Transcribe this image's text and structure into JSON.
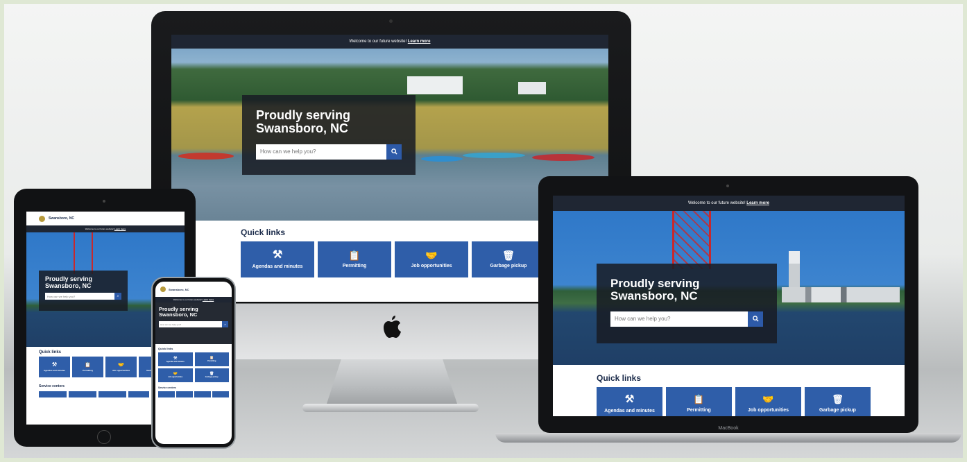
{
  "site": {
    "banner_text": "Welcome to our future website!",
    "banner_link": "Learn more",
    "hero_title_line1": "Proudly serving",
    "hero_title_line2": "Swansboro, NC",
    "search_placeholder": "How can we help you?",
    "quick_links_title": "Quick links",
    "quick_links": [
      {
        "label": "Agendas and minutes",
        "icon": "gavel-icon"
      },
      {
        "label": "Permitting",
        "icon": "clipboard-icon"
      },
      {
        "label": "Job opportunities",
        "icon": "handshake-icon"
      },
      {
        "label": "Garbage pickup",
        "icon": "trash-icon"
      }
    ],
    "brand_name": "Swansboro, NC",
    "service_centers_title": "Service centers"
  },
  "laptop": {
    "brand_label": "MacBook"
  },
  "colors": {
    "navy": "#1f2633",
    "tile_blue": "#2f5ea9",
    "accent_blue": "#2d5aa8"
  }
}
